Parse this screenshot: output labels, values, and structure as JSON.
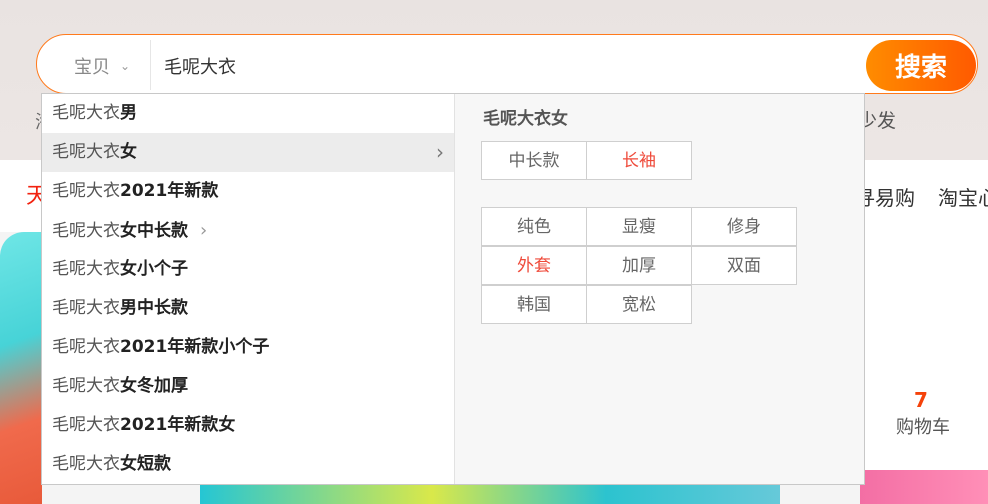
{
  "search": {
    "scope_label": "宝贝",
    "query": "毛呢大衣",
    "button_label": "搜索"
  },
  "header": {
    "nav_left_fragment": "天",
    "nav_right": [
      "寻易购",
      "淘宝心"
    ],
    "right_hint": "少发",
    "left_clip": "海"
  },
  "suggestions": [
    {
      "prefix": "毛呢大衣",
      "bold": "男"
    },
    {
      "prefix": "毛呢大衣",
      "bold": "女"
    },
    {
      "prefix": "毛呢大衣",
      "bold": "2021年新款"
    },
    {
      "prefix": "毛呢大衣",
      "bold": "女中长款"
    },
    {
      "prefix": "毛呢大衣",
      "bold": "女小个子"
    },
    {
      "prefix": "毛呢大衣",
      "bold": "男中长款"
    },
    {
      "prefix": "毛呢大衣",
      "bold": "2021年新款小个子"
    },
    {
      "prefix": "毛呢大衣",
      "bold": "女冬加厚"
    },
    {
      "prefix": "毛呢大衣",
      "bold": "2021年新款女"
    },
    {
      "prefix": "毛呢大衣",
      "bold": "女短款"
    }
  ],
  "detail": {
    "title": "毛呢大衣女",
    "group1": [
      "中长款",
      "长袖"
    ],
    "group2": [
      "纯色",
      "显瘦",
      "修身",
      "外套",
      "加厚",
      "双面",
      "韩国",
      "宽松"
    ]
  },
  "cart": {
    "count": "7",
    "label": "购物车"
  },
  "colors": {
    "accent": "#ff5a00",
    "hot_tag": "#ef4a3a"
  }
}
